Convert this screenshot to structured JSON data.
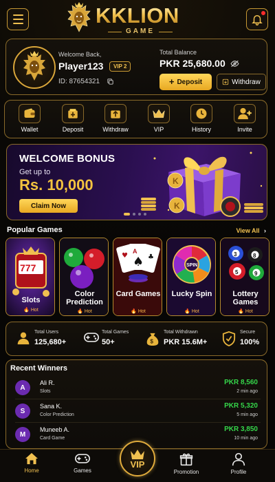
{
  "brand": {
    "name": "KKLION",
    "sub": "GAME"
  },
  "profile": {
    "welcome": "Welcome Back,",
    "username": "Player123",
    "vip": "VIP 2",
    "id": "ID: 87654321",
    "balance_label": "Total Balance",
    "balance": "PKR 25,680.00",
    "deposit_label": "Deposit",
    "withdraw_label": "Withdraw"
  },
  "actions": [
    {
      "label": "Wallet",
      "icon": "wallet-icon"
    },
    {
      "label": "Deposit",
      "icon": "deposit-icon"
    },
    {
      "label": "Withdraw",
      "icon": "withdraw-icon"
    },
    {
      "label": "VIP",
      "icon": "crown-icon"
    },
    {
      "label": "History",
      "icon": "clock-icon"
    },
    {
      "label": "Invite",
      "icon": "add-user-icon"
    }
  ],
  "banner": {
    "title": "WELCOME BONUS",
    "subtitle": "Get up to",
    "amount": "Rs. 10,000",
    "button": "Claim Now",
    "slides": 4,
    "active_slide": 1
  },
  "popular": {
    "title": "Popular Games",
    "view_all": "View All",
    "games": [
      {
        "name": "Slots",
        "tag": "Hot"
      },
      {
        "name": "Color Prediction",
        "tag": "Hot"
      },
      {
        "name": "Card Games",
        "tag": "Hot"
      },
      {
        "name": "Lucky Spin",
        "tag": "Hot"
      },
      {
        "name": "Lottery Games",
        "tag": "Hot"
      }
    ]
  },
  "stats": [
    {
      "label": "Total Users",
      "value": "125,680+",
      "icon": "user-icon"
    },
    {
      "label": "Total Games",
      "value": "50+",
      "icon": "gamepad-icon"
    },
    {
      "label": "Total Withdrawn",
      "value": "PKR 15.6M+",
      "icon": "money-bag-icon"
    },
    {
      "label": "Secure",
      "value": "100%",
      "icon": "shield-icon"
    }
  ],
  "winners": {
    "title": "Recent Winners",
    "rows": [
      {
        "initial": "A",
        "name": "Ali R.",
        "game": "Slots",
        "amount": "PKR 8,560",
        "time": "2 min ago"
      },
      {
        "initial": "S",
        "name": "Sana K.",
        "game": "Color Prediction",
        "amount": "PKR 5,320",
        "time": "5 min ago"
      },
      {
        "initial": "M",
        "name": "Muneeb A.",
        "game": "Card Game",
        "amount": "PKR 3,850",
        "time": "10 min ago"
      }
    ]
  },
  "nav": {
    "home": "Home",
    "games": "Games",
    "vip": "VIP",
    "promotion": "Promotion",
    "profile": "Profile"
  },
  "colors": {
    "gold": "#f0c050",
    "green": "#35d64a",
    "purple": "#6b2bb0",
    "background": "#0b0906"
  }
}
